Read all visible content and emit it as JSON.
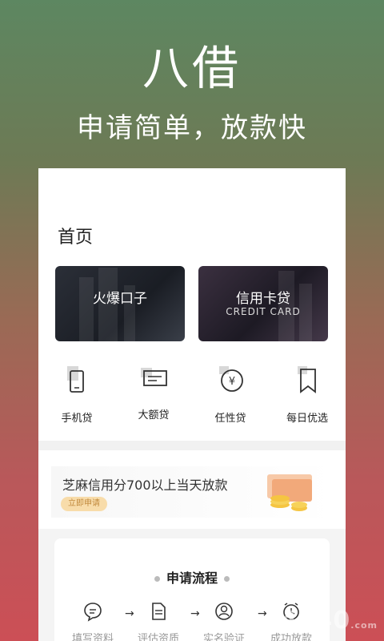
{
  "header": {
    "title": "八借",
    "slogan": "申请简单，放款快"
  },
  "home": {
    "title": "首页"
  },
  "banners": [
    {
      "title": "火爆口子",
      "subtitle": ""
    },
    {
      "title": "信用卡贷",
      "subtitle": "CREDIT CARD"
    }
  ],
  "categories": [
    {
      "label": "手机贷",
      "icon": "phone-icon"
    },
    {
      "label": "大额贷",
      "icon": "card-icon"
    },
    {
      "label": "任性贷",
      "icon": "yen-coin-icon"
    },
    {
      "label": "每日优选",
      "icon": "bookmark-icon"
    }
  ],
  "promo": {
    "text": "芝麻信用分700以上当天放款",
    "button": "立即申请"
  },
  "process": {
    "title": "申请流程",
    "steps": [
      {
        "label": "填写资料",
        "icon": "chat-icon"
      },
      {
        "label": "评估资质",
        "icon": "document-icon"
      },
      {
        "label": "实名验证",
        "icon": "user-icon"
      },
      {
        "label": "成功放款",
        "icon": "alarm-icon"
      }
    ]
  },
  "watermark": {
    "text": "4040",
    "suffix": ".com"
  },
  "colors": {
    "gradient_top": "#5d8761",
    "gradient_bottom": "#cc4f56",
    "promo_button": "#f8dcaa"
  }
}
